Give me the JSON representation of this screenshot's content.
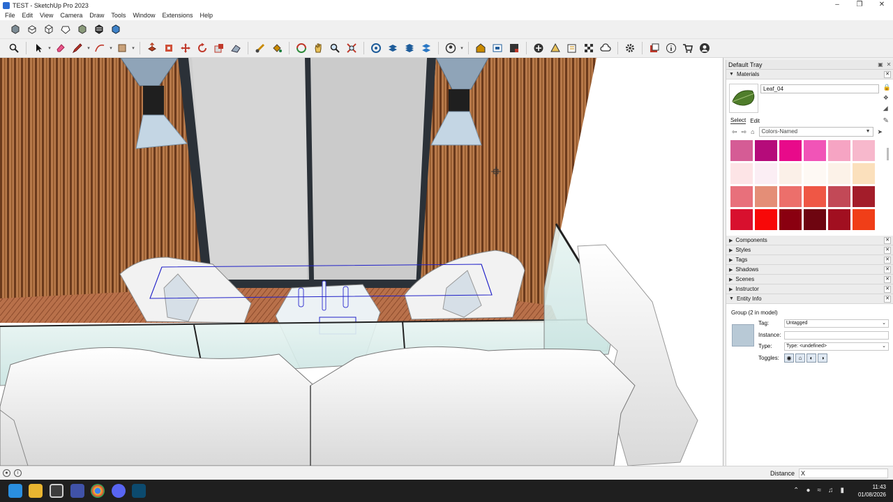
{
  "window": {
    "title": "TEST - SketchUp Pro 2023"
  },
  "menu": [
    "File",
    "Edit",
    "View",
    "Camera",
    "Draw",
    "Tools",
    "Window",
    "Extensions",
    "Help"
  ],
  "toolbar1": [
    "iso-view-icon",
    "top-view-icon",
    "front-view-icon",
    "right-view-icon",
    "back-view-icon",
    "left-view-icon",
    "bottom-view-icon"
  ],
  "tray": {
    "title": "Default Tray",
    "materials": {
      "header": "Materials",
      "name": "Leaf_04",
      "tab_select": "Select",
      "tab_edit": "Edit",
      "library": "Colors-Named",
      "swatches": [
        "#d55c95",
        "#b50b7a",
        "#e80a8a",
        "#f154b7",
        "#f6a4c3",
        "#f7b8cc",
        "#fde4e6",
        "#fbeef4",
        "#fbf0e8",
        "#fef9f4",
        "#fcf2e8",
        "#fbe0bc",
        "#e8707b",
        "#e48e77",
        "#ec6f6b",
        "#ef5745",
        "#c24957",
        "#a31d2a",
        "#d8102e",
        "#f80808",
        "#8a0010",
        "#6e0510",
        "#a10f20",
        "#f03e18"
      ]
    },
    "sections": [
      "Components",
      "Styles",
      "Tags",
      "Shadows",
      "Scenes",
      "Instructor"
    ],
    "entity_info": {
      "header": "Entity Info",
      "title": "Group (2 in model)",
      "tag_label": "Tag:",
      "tag_value": "Untagged",
      "instance_label": "Instance:",
      "instance_value": "",
      "type_label": "Type:",
      "type_value": "Type: <undefined>",
      "toggles_label": "Toggles:"
    }
  },
  "status": {
    "vcb_label": "Distance",
    "vcb_value": "X"
  },
  "clock": {
    "time": "11:43",
    "date": "01/08/2026"
  }
}
